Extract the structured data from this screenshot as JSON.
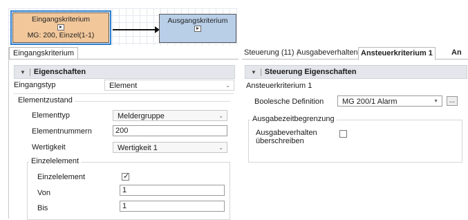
{
  "diagram": {
    "node1": {
      "title": "Eingangskriterium",
      "sub": "MG: 200, Einzel(1-1)"
    },
    "node2": {
      "title": "Ausgangskriterium"
    }
  },
  "left": {
    "tab": "Eingangskriterium",
    "group": "Eigenschaften",
    "eingangstyp": {
      "label": "Eingangstyp",
      "value": "Element"
    },
    "elementzustand": "Elementzustand",
    "elementtyp": {
      "label": "Elementtyp",
      "value": "Meldergruppe"
    },
    "elementnummern": {
      "label": "Elementnummern",
      "value": "200"
    },
    "wertigkeit": {
      "label": "Wertigkeit",
      "value": "Wertigkeit 1"
    },
    "einzelelement_group": "Einzelelement",
    "einzelelement": {
      "label": "Einzelelement",
      "checked": true
    },
    "von": {
      "label": "Von",
      "value": "1"
    },
    "bis": {
      "label": "Bis",
      "value": "1"
    }
  },
  "right": {
    "tabs": [
      {
        "label": "Steuerung (11)"
      },
      {
        "label": "Ausgabeverhalten"
      },
      {
        "label": "Ansteuerkriterium 1"
      },
      {
        "label": "An"
      }
    ],
    "group": "Steuerung Eigenschaften",
    "ansteuerkriterium": "Ansteuerkriterium 1",
    "boolesche": {
      "label": "Boolesche Definition",
      "value": "MG 200/1 Alarm",
      "button": "..."
    },
    "ausgabezeit": "Ausgabezeitbegrenzung",
    "ausgabeverhalten": {
      "label_line1": "Ausgabeverhalten",
      "label_line2": "überschreiben",
      "checked": false
    }
  }
}
